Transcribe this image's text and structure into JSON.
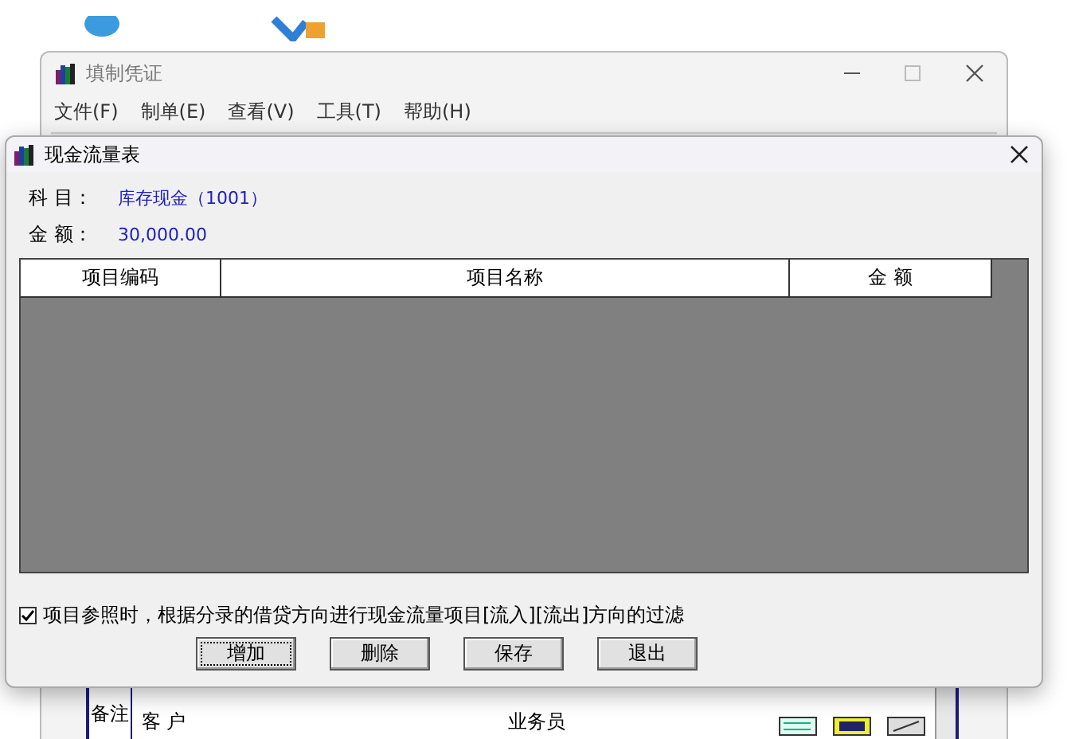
{
  "background_window": {
    "title": "填制凭证",
    "menu": [
      "文件(F)",
      "制单(E)",
      "查看(V)",
      "工具(T)",
      "帮助(H)"
    ],
    "remarks": {
      "label": "备注",
      "fields": [
        "客 户",
        "业务员"
      ]
    }
  },
  "dialog": {
    "title": "现金流量表",
    "subject": {
      "label": "科 目：",
      "value": "库存现金（1001）"
    },
    "amount": {
      "label": "金 额：",
      "value": "30,000.00"
    },
    "table": {
      "columns": [
        "项目编码",
        "项目名称",
        "金 额"
      ]
    },
    "filter": {
      "label": "项目参照时，根据分录的借贷方向进行现金流量项目[流入][流出]方向的过滤",
      "checked": true
    },
    "buttons": [
      {
        "label": "增加",
        "focused": true
      },
      {
        "label": "删除",
        "focused": false
      },
      {
        "label": "保存",
        "focused": false
      },
      {
        "label": "退出",
        "focused": false
      }
    ]
  }
}
